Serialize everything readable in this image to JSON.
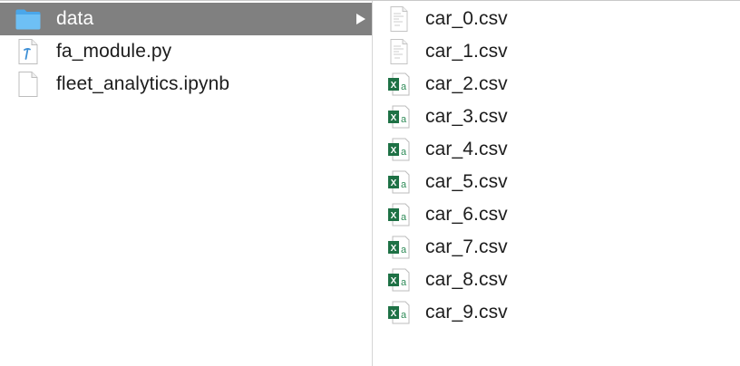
{
  "left_column": {
    "items": [
      {
        "name": "data",
        "kind": "folder-icon",
        "selected": true
      },
      {
        "name": "fa_module.py",
        "kind": "python-file-icon",
        "selected": false
      },
      {
        "name": "fleet_analytics.ipynb",
        "kind": "blank-document-icon",
        "selected": false
      }
    ]
  },
  "right_column": {
    "items": [
      {
        "name": "car_0.csv",
        "kind": "generic-document-icon"
      },
      {
        "name": "car_1.csv",
        "kind": "generic-document-icon"
      },
      {
        "name": "car_2.csv",
        "kind": "excel-csv-icon"
      },
      {
        "name": "car_3.csv",
        "kind": "excel-csv-icon"
      },
      {
        "name": "car_4.csv",
        "kind": "excel-csv-icon"
      },
      {
        "name": "car_5.csv",
        "kind": "excel-csv-icon"
      },
      {
        "name": "car_6.csv",
        "kind": "excel-csv-icon"
      },
      {
        "name": "car_7.csv",
        "kind": "excel-csv-icon"
      },
      {
        "name": "car_8.csv",
        "kind": "excel-csv-icon"
      },
      {
        "name": "car_9.csv",
        "kind": "excel-csv-icon"
      }
    ]
  },
  "colors": {
    "selection": "#808080",
    "folder": "#5fb4ef",
    "excel_green": "#1e7145",
    "python_blue": "#3d8fd6"
  }
}
